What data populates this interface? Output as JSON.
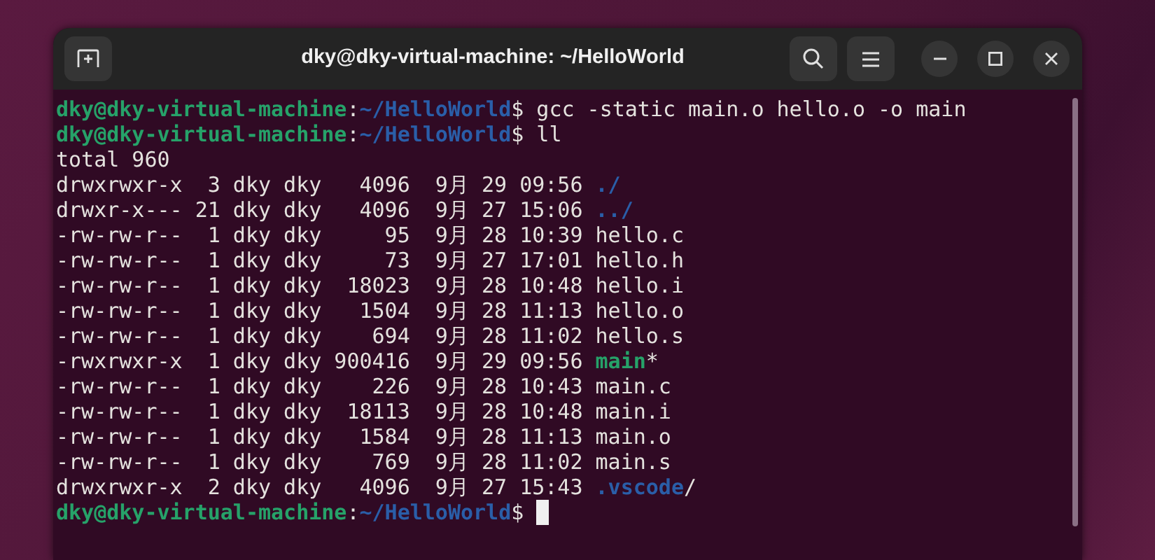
{
  "window": {
    "title": "dky@dky-virtual-machine: ~/HelloWorld"
  },
  "terminal": {
    "lines": [
      {
        "kind": "prompt",
        "user_host": "dky@dky-virtual-machine",
        "separator": ":",
        "path": "~/HelloWorld",
        "symbol": "$",
        "command": "gcc -static main.o hello.o -o main",
        "cursor": false
      },
      {
        "kind": "prompt",
        "user_host": "dky@dky-virtual-machine",
        "separator": ":",
        "path": "~/HelloWorld",
        "symbol": "$",
        "command": "ll",
        "cursor": false
      },
      {
        "kind": "text",
        "text": "total 960"
      },
      {
        "kind": "dir_entry",
        "info": "drwxrwxr-x  3 dky dky   4096  9月 29 09:56",
        "name": "./"
      },
      {
        "kind": "dir_entry",
        "info": "drwxr-x--- 21 dky dky   4096  9月 27 15:06",
        "name": "../"
      },
      {
        "kind": "file_entry",
        "info": "-rw-rw-r--  1 dky dky     95  9月 28 10:39",
        "name": "hello.c"
      },
      {
        "kind": "file_entry",
        "info": "-rw-rw-r--  1 dky dky     73  9月 27 17:01",
        "name": "hello.h"
      },
      {
        "kind": "file_entry",
        "info": "-rw-rw-r--  1 dky dky  18023  9月 28 10:48",
        "name": "hello.i"
      },
      {
        "kind": "file_entry",
        "info": "-rw-rw-r--  1 dky dky   1504  9月 28 11:13",
        "name": "hello.o"
      },
      {
        "kind": "file_entry",
        "info": "-rw-rw-r--  1 dky dky    694  9月 28 11:02",
        "name": "hello.s"
      },
      {
        "kind": "exec_entry",
        "info": "-rwxrwxr-x  1 dky dky 900416  9月 29 09:56",
        "name": "main",
        "suffix": "*"
      },
      {
        "kind": "file_entry",
        "info": "-rw-rw-r--  1 dky dky    226  9月 28 10:43",
        "name": "main.c"
      },
      {
        "kind": "file_entry",
        "info": "-rw-rw-r--  1 dky dky  18113  9月 28 10:48",
        "name": "main.i"
      },
      {
        "kind": "file_entry",
        "info": "-rw-rw-r--  1 dky dky   1584  9月 28 11:13",
        "name": "main.o"
      },
      {
        "kind": "file_entry",
        "info": "-rw-rw-r--  1 dky dky    769  9月 28 11:02",
        "name": "main.s"
      },
      {
        "kind": "dir_entry",
        "info": "drwxrwxr-x  2 dky dky   4096  9月 27 15:43",
        "name": ".vscode",
        "suffix": "/"
      },
      {
        "kind": "prompt",
        "user_host": "dky@dky-virtual-machine",
        "separator": ":",
        "path": "~/HelloWorld",
        "symbol": "$",
        "cursor": true
      }
    ]
  }
}
